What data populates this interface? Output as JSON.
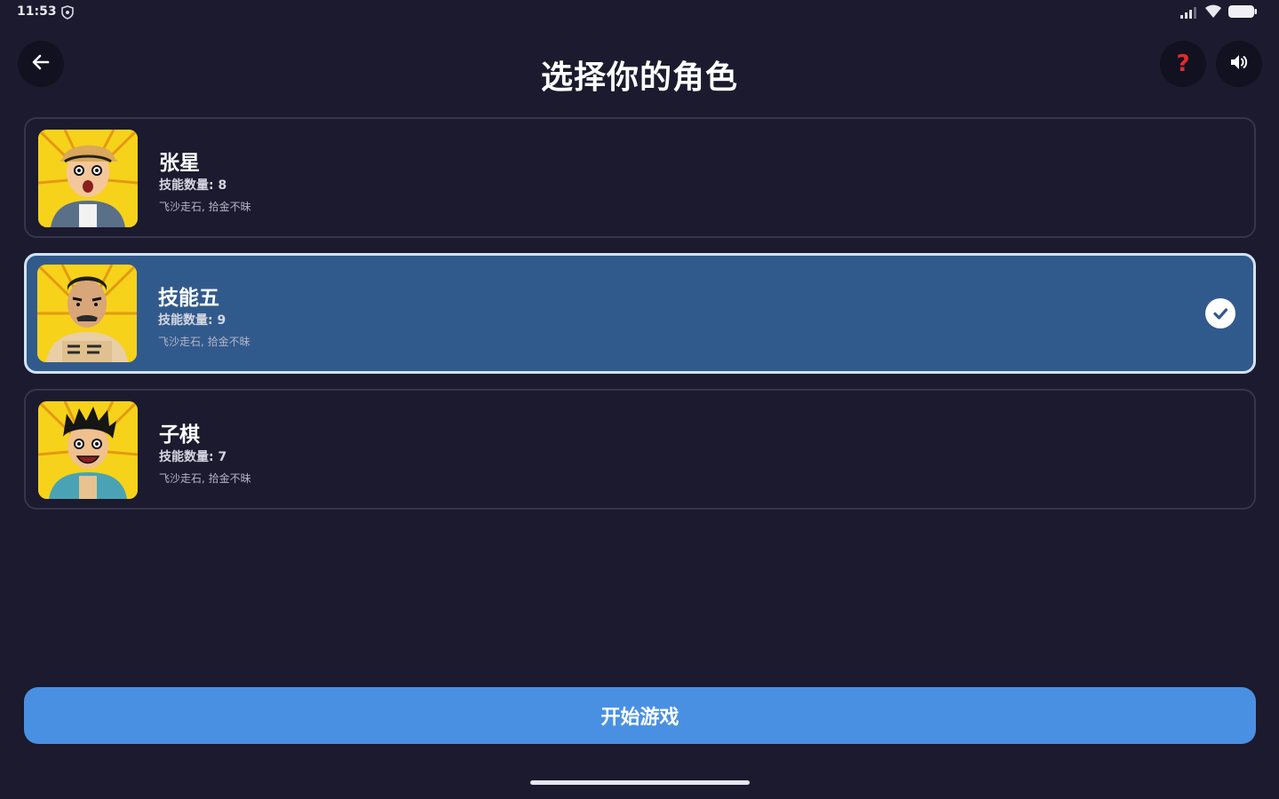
{
  "status_bar": {
    "time": "11:53",
    "icons": [
      "shield-icon",
      "signal-icon",
      "wifi-icon",
      "battery-icon"
    ]
  },
  "header": {
    "title": "选择你的角色",
    "back_icon": "arrow-left-icon",
    "help_label": "?",
    "help_color": "#e02b2b",
    "sound_icon": "speaker-icon"
  },
  "characters": [
    {
      "name": "张星",
      "skill_count": "技能数量: 8",
      "skills": "飞沙走石, 拾金不昧",
      "selected": false
    },
    {
      "name": "技能五",
      "skill_count": "技能数量: 9",
      "skills": "飞沙走石, 拾金不昧",
      "selected": true
    },
    {
      "name": "子棋",
      "skill_count": "技能数量: 7",
      "skills": "飞沙走石, 拾金不昧",
      "selected": false
    }
  ],
  "footer": {
    "start_label": "开始游戏"
  },
  "colors": {
    "background": "#1b1a2e",
    "selected_card": "#315a8c",
    "primary_button": "#4a90e2",
    "avatar_bg": "#f7d21b"
  }
}
